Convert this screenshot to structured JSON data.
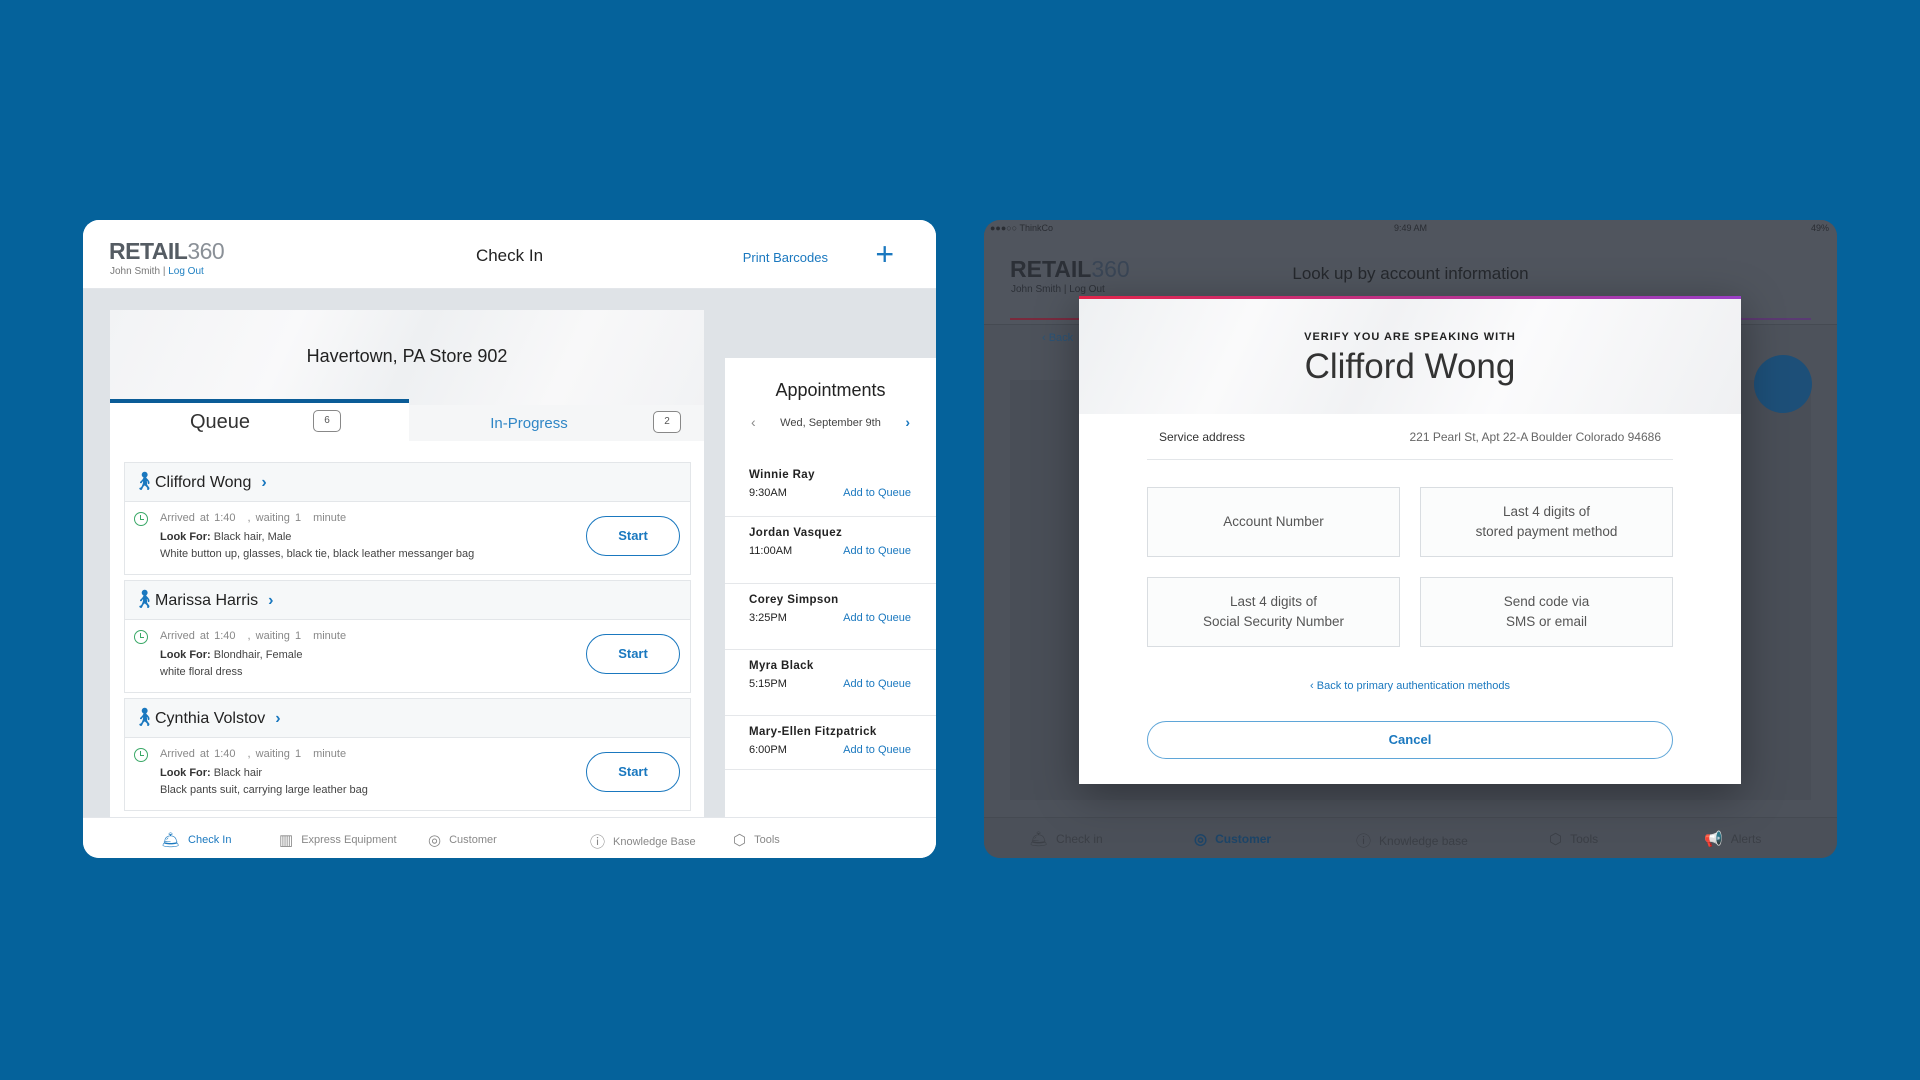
{
  "left": {
    "logo": {
      "brand": "RETAIL",
      "num": "360"
    },
    "user": {
      "name": "John Smith",
      "sep": "|",
      "logout": "Log Out"
    },
    "title": "Check In",
    "print_barcodes": "Print Barcodes",
    "add_icon": "plus-icon",
    "store": "Havertown, PA Store 902",
    "tabs": [
      {
        "label": "Queue",
        "count": "6",
        "active": true
      },
      {
        "label": "In-Progress",
        "count": "2"
      }
    ],
    "queue": [
      {
        "name": "Clifford Wong",
        "arrived": "Arrived at 1:40",
        "waiting": ", waiting 1",
        "unit": "minute",
        "look_label": "Look For:",
        "look": "Black hair, Male",
        "desc": "White button up, glasses, black tie, black leather messanger bag",
        "action": "Start"
      },
      {
        "name": "Marissa Harris",
        "arrived": "Arrived at 1:40",
        "waiting": ", waiting 1",
        "unit": "minute",
        "look_label": "Look For:",
        "look": "Blondhair, Female",
        "desc": "white floral dress",
        "action": "Start"
      },
      {
        "name": "Cynthia Volstov",
        "arrived": "Arrived at 1:40",
        "waiting": ", waiting 1",
        "unit": "minute",
        "look_label": "Look For:",
        "look": "Black hair",
        "desc": "Black pants suit, carrying large leather bag",
        "action": "Start"
      }
    ],
    "appointments": {
      "title": "Appointments",
      "date": "Wed, September 9th",
      "items": [
        {
          "name": "Winnie Ray",
          "time": "9:30AM",
          "action": "Add to Queue"
        },
        {
          "name": "Jordan Vasquez",
          "time": "11:00AM",
          "action": "Add to Queue"
        },
        {
          "name": "Corey Simpson",
          "time": "3:25PM",
          "action": "Add to Queue"
        },
        {
          "name": "Myra Black",
          "time": "5:15PM",
          "action": "Add to Queue"
        },
        {
          "name": "Mary-Ellen Fitzpatrick",
          "time": "6:00PM",
          "action": "Add to Queue"
        }
      ]
    },
    "nav": [
      {
        "label": "Check In",
        "icon": "bell-icon",
        "active": true
      },
      {
        "label": "Express Equipment",
        "icon": "barcode-icon"
      },
      {
        "label": "Customer",
        "icon": "user-icon"
      },
      {
        "label": "Knowledge Base",
        "icon": "question-icon"
      },
      {
        "label": "Tools",
        "icon": "hexagon-icon"
      }
    ]
  },
  "right": {
    "status": {
      "carrier": "●●●○○ ThinkCo",
      "time": "9:49 AM",
      "battery": "49%"
    },
    "logo": {
      "brand": "RETAIL",
      "num": "360"
    },
    "user": {
      "name": "John Smith",
      "sep": "|",
      "logout": "Log Out"
    },
    "title": "Look up by account information",
    "back": "‹ Back",
    "modal": {
      "eyebrow": "VERIFY YOU ARE SPEAKING WITH",
      "name": "Clifford Wong",
      "service_label": "Service address",
      "service_value": "221 Pearl St, Apt 22-A Boulder Colorado 94686",
      "options": [
        "Account Number",
        "Last 4 digits of\nstored payment method",
        "Last 4 digits of\nSocial Security Number",
        "Send code via\nSMS or email"
      ],
      "back_link": "‹ Back to primary authentication methods",
      "cancel": "Cancel"
    },
    "nav": [
      {
        "label": "Check in",
        "icon": "bell-icon"
      },
      {
        "label": "Customer",
        "icon": "user-icon",
        "active": true
      },
      {
        "label": "Knowledge base",
        "icon": "question-icon"
      },
      {
        "label": "Tools",
        "icon": "hexagon-icon"
      },
      {
        "label": "Alerts",
        "icon": "megaphone-icon"
      }
    ]
  },
  "colors": {
    "background": "#05629b",
    "accent": "#1a78bf",
    "tab_active": "#0b5c97",
    "clock": "#3aa867"
  }
}
